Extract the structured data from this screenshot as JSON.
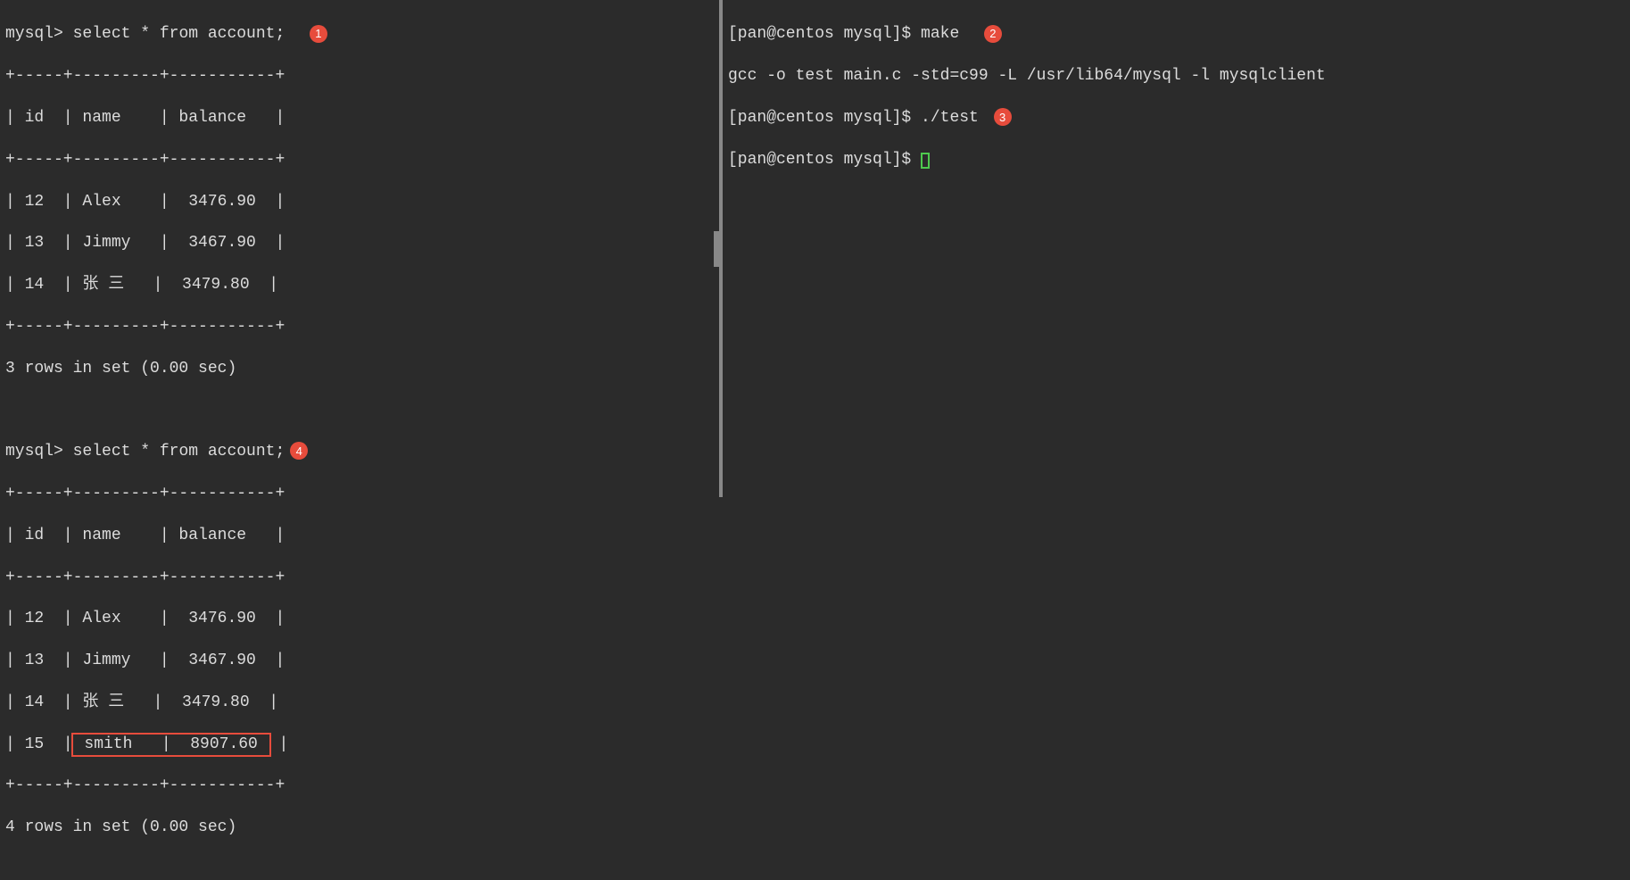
{
  "left": {
    "prompt1": "mysql> ",
    "query1": "select * from account;",
    "badge1": "1",
    "table1": {
      "border_top": "+-----+---------+-----------+",
      "header": "| id  | name    | balance   |",
      "border_mid": "+-----+---------+-----------+",
      "row1": "| 12  | Alex    |  3476.90  |",
      "row2": "| 13  | Jimmy   |  3467.90  |",
      "row3": "| 14  | 张 三   |  3479.80  |",
      "border_bot": "+-----+---------+-----------+",
      "footer": "3 rows in set (0.00 sec)"
    },
    "prompt2": "mysql> ",
    "query2": "select * from account;",
    "badge4": "4",
    "table2": {
      "border_top": "+-----+---------+-----------+",
      "header": "| id  | name    | balance   |",
      "border_mid": "+-----+---------+-----------+",
      "row1": "| 12  | Alex    |  3476.90  |",
      "row2": "| 13  | Jimmy   |  3467.90  |",
      "row3": "| 14  | 张 三   |  3479.80  |",
      "row4_prefix": "| 15  |",
      "row4_highlight": " smith   |  8907.60 ",
      "row4_suffix": " |",
      "border_bot": "+-----+---------+-----------+",
      "footer": "4 rows in set (0.00 sec)"
    }
  },
  "right": {
    "prompt": "[pan@centos mysql]$ ",
    "cmd1": "make",
    "badge2": "2",
    "gcc_line": "gcc -o test main.c -std=c99 -L /usr/lib64/mysql -l mysqlclient",
    "cmd2": "./test",
    "badge3": "3"
  },
  "chart_data": {
    "type": "table",
    "note": "Two MySQL result tables; second has an extra highlighted row",
    "tables": [
      {
        "columns": [
          "id",
          "name",
          "balance"
        ],
        "rows": [
          {
            "id": 12,
            "name": "Alex",
            "balance": 3476.9
          },
          {
            "id": 13,
            "name": "Jimmy",
            "balance": 3467.9
          },
          {
            "id": 14,
            "name": "张 三",
            "balance": 3479.8
          }
        ],
        "footer": "3 rows in set (0.00 sec)"
      },
      {
        "columns": [
          "id",
          "name",
          "balance"
        ],
        "rows": [
          {
            "id": 12,
            "name": "Alex",
            "balance": 3476.9
          },
          {
            "id": 13,
            "name": "Jimmy",
            "balance": 3467.9
          },
          {
            "id": 14,
            "name": "张 三",
            "balance": 3479.8
          },
          {
            "id": 15,
            "name": "smith",
            "balance": 8907.6,
            "highlighted": true
          }
        ],
        "footer": "4 rows in set (0.00 sec)"
      }
    ]
  }
}
